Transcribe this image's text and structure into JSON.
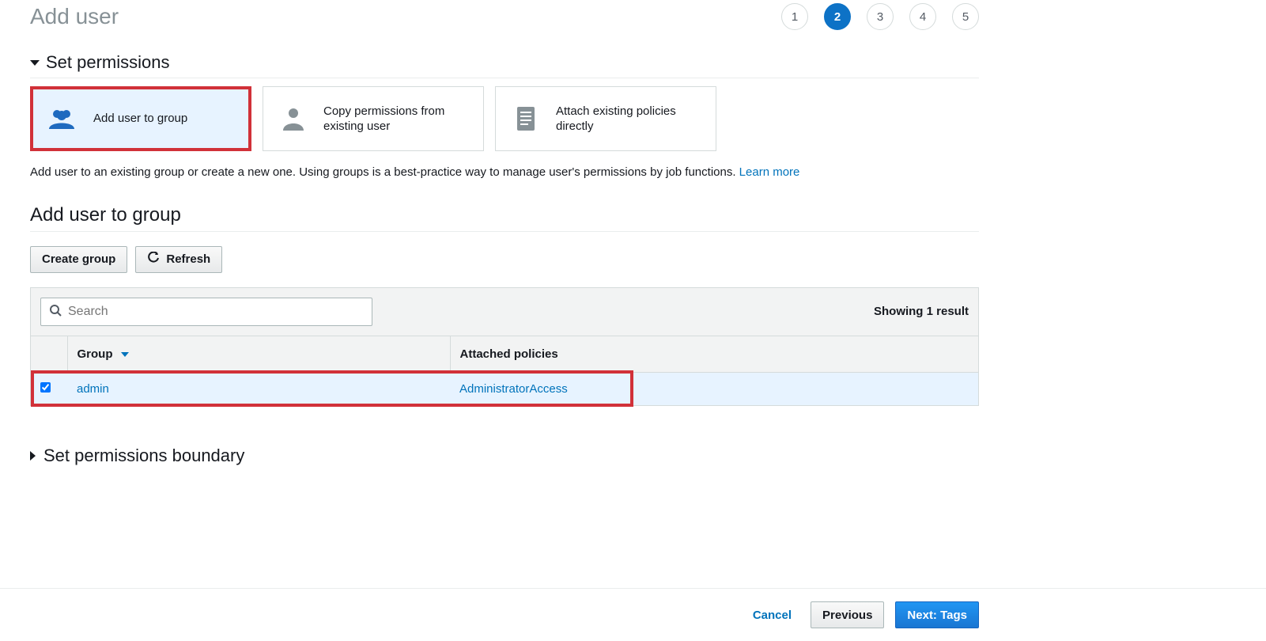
{
  "page": {
    "title": "Add user"
  },
  "wizard": {
    "steps": [
      "1",
      "2",
      "3",
      "4",
      "5"
    ],
    "active_index": 1
  },
  "permissions": {
    "section_title": "Set permissions",
    "tiles": {
      "add_to_group": "Add user to group",
      "copy_from_user": "Copy permissions from existing user",
      "attach_policies": "Attach existing policies directly"
    },
    "hint_text": "Add user to an existing group or create a new one. Using groups is a best-practice way to manage user's permissions by job functions. ",
    "hint_link": "Learn more"
  },
  "group_panel": {
    "title": "Add user to group",
    "buttons": {
      "create": "Create group",
      "refresh": "Refresh"
    },
    "search_placeholder": "Search",
    "results_text": "Showing 1 result",
    "columns": {
      "group": "Group",
      "policies": "Attached policies"
    },
    "rows": [
      {
        "checked": true,
        "group": "admin",
        "policies": "AdministratorAccess"
      }
    ]
  },
  "boundary": {
    "title": "Set permissions boundary"
  },
  "footer": {
    "cancel": "Cancel",
    "previous": "Previous",
    "next": "Next: Tags"
  }
}
